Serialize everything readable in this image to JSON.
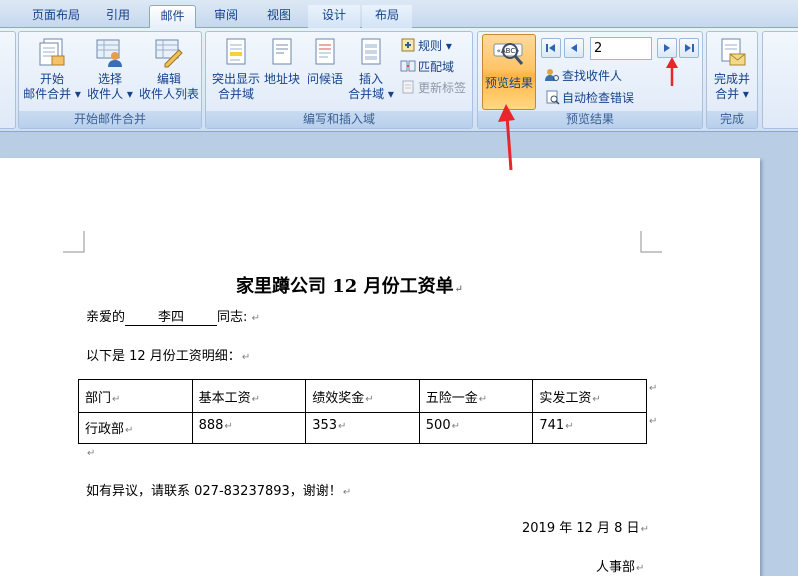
{
  "tabs": [
    "页面布局",
    "引用",
    "邮件",
    "审阅",
    "视图",
    "设计",
    "布局"
  ],
  "ribbon": {
    "groups": {
      "start_merge": {
        "label": "开始邮件合并",
        "start_btn": [
          "开始",
          "邮件合并"
        ],
        "select_btn": [
          "选择",
          "收件人"
        ],
        "edit_btn": [
          "编辑",
          "收件人列表"
        ]
      },
      "write_insert": {
        "label": "编写和插入域",
        "highlight_btn": [
          "突出显示",
          "合并域"
        ],
        "address_btn": "地址块",
        "greeting_btn": "问候语",
        "insert_btn": [
          "插入",
          "合并域"
        ],
        "rules": "规则",
        "match_fields": "匹配域",
        "update_labels": "更新标签"
      },
      "preview": {
        "label": "预览结果",
        "preview_btn": "预览结果",
        "record_number": "2",
        "find_recipient": "查找收件人",
        "auto_check": "自动检查错误"
      },
      "finish": {
        "label": "完成",
        "finish_btn": [
          "完成并",
          "合并"
        ]
      }
    }
  },
  "document": {
    "title": "家里蹲公司 12 月份工资单",
    "greeting_prefix": "亲爱的",
    "recipient_name": "李四",
    "greeting_suffix": "同志:",
    "intro": "以下是 12 月份工资明细：",
    "table": {
      "headers": [
        "部门",
        "基本工资",
        "绩效奖金",
        "五险一金",
        "实发工资"
      ],
      "rows": [
        [
          "行政部",
          "888",
          "353",
          "500",
          "741"
        ]
      ]
    },
    "contact": "如有异议，请联系 027-83237893，谢谢！",
    "date": "2019 年 12 月 8 日",
    "signature": "人事部"
  },
  "colors": {
    "ribbon_text": "#15428b",
    "active_button": "#ffc56a",
    "annotation_arrow": "#e8252b"
  }
}
